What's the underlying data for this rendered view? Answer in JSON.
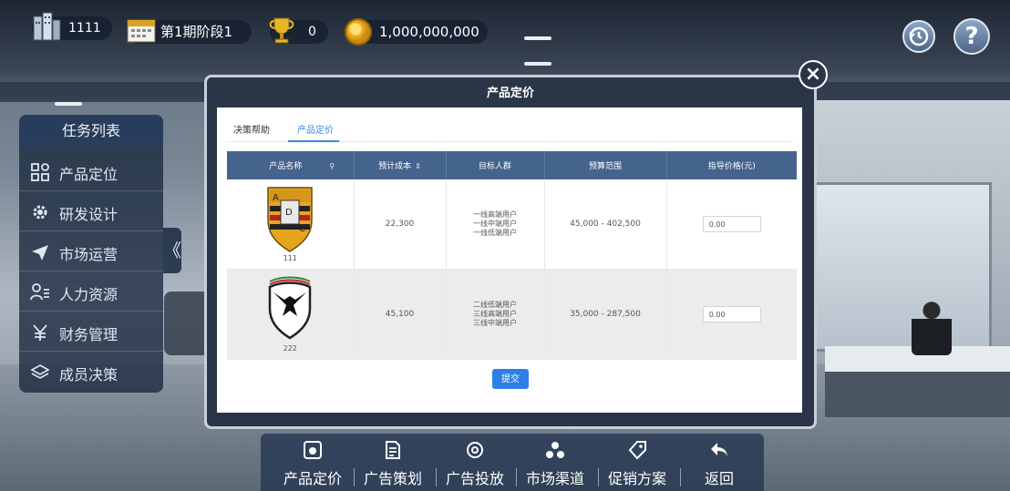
{
  "topbar": {
    "company": "1111",
    "period": "第1期阶段1",
    "trophies": "0",
    "money": "1,000,000,000"
  },
  "sidebar": {
    "title": "任务列表",
    "items": [
      {
        "label": "产品定位",
        "icon": "grid-icon"
      },
      {
        "label": "研发设计",
        "icon": "gear-icon"
      },
      {
        "label": "市场运营",
        "icon": "paper-plane-icon"
      },
      {
        "label": "人力资源",
        "icon": "person-list-icon"
      },
      {
        "label": "财务管理",
        "icon": "yen-icon"
      },
      {
        "label": "成员决策",
        "icon": "layers-icon"
      }
    ],
    "collapse_glyph": "《"
  },
  "modal": {
    "title": "产品定价",
    "close_glyph": "×",
    "tabs": [
      {
        "label": "决策帮助",
        "active": false
      },
      {
        "label": "产品定价",
        "active": true
      }
    ],
    "columns": [
      "产品名称",
      "预计成本",
      "目标人群",
      "预算范围",
      "指导价格(元)"
    ],
    "rows": [
      {
        "name": "111",
        "cost": "22,300",
        "targets": [
          "一线高端用户",
          "一线中端用户",
          "一线低端用户"
        ],
        "budget": "45,000 - 402,500",
        "price": "0.00"
      },
      {
        "name": "222",
        "cost": "45,100",
        "targets": [
          "二线低端用户",
          "三线高端用户",
          "三线中端用户"
        ],
        "budget": "35,000 - 287,500",
        "price": "0.00"
      }
    ],
    "submit_label": "提交",
    "accent": "#2f7ee6",
    "header_color": "#44638d"
  },
  "bottombar": {
    "items": [
      {
        "label": "产品定价",
        "icon": "price-tag-icon",
        "active": true
      },
      {
        "label": "广告策划",
        "icon": "document-icon"
      },
      {
        "label": "广告投放",
        "icon": "target-icon"
      },
      {
        "label": "市场渠道",
        "icon": "channels-icon"
      },
      {
        "label": "促销方案",
        "icon": "promo-tag-icon"
      },
      {
        "label": "返回",
        "icon": "back-arrow-icon"
      }
    ]
  }
}
